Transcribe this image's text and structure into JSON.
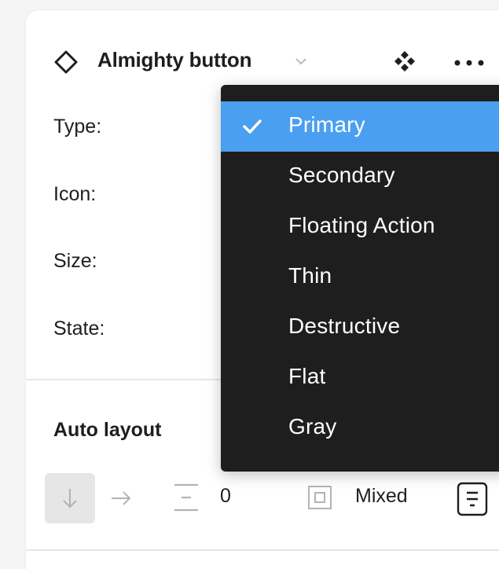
{
  "header": {
    "title": "Almighty button"
  },
  "properties": [
    {
      "label": "Type:"
    },
    {
      "label": "Icon:"
    },
    {
      "label": "Size:"
    },
    {
      "label": "State:"
    }
  ],
  "auto_layout": {
    "title": "Auto layout",
    "spacing_value": "0",
    "padding_value": "Mixed"
  },
  "dropdown": {
    "selected": "Primary",
    "options": [
      "Primary",
      "Secondary",
      "Floating Action",
      "Thin",
      "Destructive",
      "Flat",
      "Gray"
    ]
  },
  "colors": {
    "selection": "#4a9ff0",
    "menu_background": "#1e1e1e",
    "panel_background": "#ffffff",
    "page_background": "#f5f5f5"
  }
}
